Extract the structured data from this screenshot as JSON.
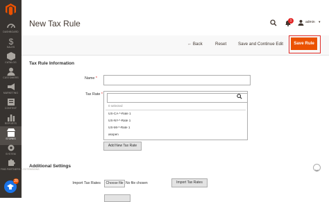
{
  "sidebar": {
    "items": [
      {
        "label": "DASHBOARD",
        "icon": "dashboard-icon"
      },
      {
        "label": "SALES",
        "icon": "dollar-icon"
      },
      {
        "label": "CATALOG",
        "icon": "box-icon"
      },
      {
        "label": "CUSTOMERS",
        "icon": "customers-icon"
      },
      {
        "label": "MARKETING",
        "icon": "megaphone-icon"
      },
      {
        "label": "CONTENT",
        "icon": "content-icon"
      },
      {
        "label": "REPORTS",
        "icon": "bar-chart-icon"
      },
      {
        "label": "STORES",
        "icon": "store-icon",
        "active": true
      },
      {
        "label": "SYSTEM",
        "icon": "gear-icon"
      },
      {
        "label": "FIND PARTNERS & EXTENSIONS",
        "icon": "puzzle-icon"
      }
    ],
    "fab_badge": "20"
  },
  "header": {
    "title": "New Tax Rule",
    "notification_count": "1",
    "user_name": "admin"
  },
  "toolbar": {
    "back_label": "Back",
    "reset_label": "Reset",
    "save_continue_label": "Save and Continue Edit",
    "save_rule_label": "Save Rule"
  },
  "form": {
    "section_title": "Tax Rule Information",
    "name_label": "Name",
    "name_value": "",
    "tax_rate_label": "Tax Rate",
    "search_value": "",
    "selected_text": "0 selected",
    "rates": [
      "US-CA-*-Rate 1",
      "US-NY-*-Rate 1",
      "US-MI-*-Rate 1",
      "asxpen"
    ],
    "add_rate_label": "Add New Tax Rate"
  },
  "additional": {
    "section_title": "Additional Settings",
    "import_label": "Import Tax Rates",
    "choose_file_label": "Choose file",
    "no_file_text": "No file chosen",
    "import_button_label": "Import Tax Rates"
  },
  "colors": {
    "sidebar": "#373330",
    "accent": "#eb5202",
    "highlight_border": "#e02b27"
  }
}
